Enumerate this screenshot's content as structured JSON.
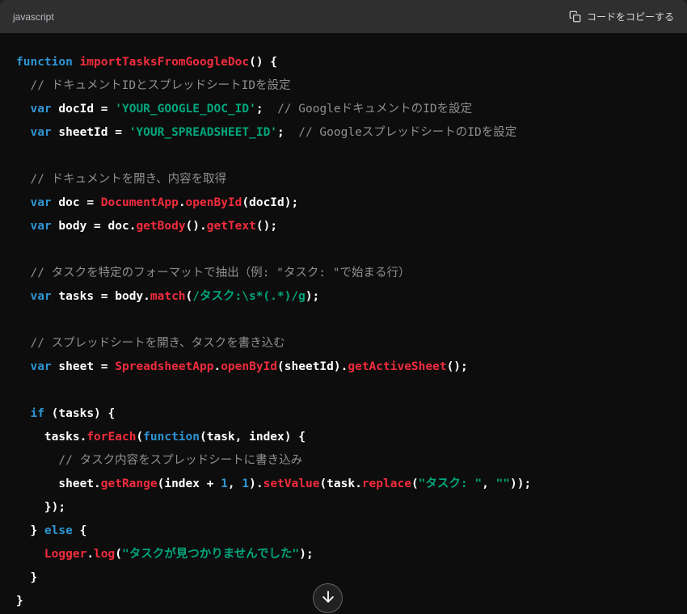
{
  "header": {
    "language": "javascript",
    "copy_label": "コードをコピーする"
  },
  "colors": {
    "page_bg": "#212121",
    "code_bg": "#0d0d0d",
    "header_bg": "#2f2f2f",
    "header_text": "#b8bcc3",
    "header_text2": "#d7d7d7",
    "keyword": "#2e95d3",
    "function": "#f22c3d",
    "string": "#00a67d",
    "number": "#2e95d3",
    "comment": "#8f8f8f",
    "plain": "#ffffff"
  },
  "code": {
    "lines": [
      [
        {
          "s": "function",
          "c": "kw"
        },
        {
          "s": " ",
          "c": "pl"
        },
        {
          "s": "importTasksFromGoogleDoc",
          "c": "fn"
        },
        {
          "s": "() {",
          "c": "pl"
        }
      ],
      [
        {
          "s": "  ",
          "c": "pl"
        },
        {
          "s": "// ドキュメントIDとスプレッドシートIDを設定",
          "c": "com"
        }
      ],
      [
        {
          "s": "  ",
          "c": "pl"
        },
        {
          "s": "var",
          "c": "kw"
        },
        {
          "s": " docId = ",
          "c": "pl"
        },
        {
          "s": "'YOUR_GOOGLE_DOC_ID'",
          "c": "str"
        },
        {
          "s": ";  ",
          "c": "pl"
        },
        {
          "s": "// GoogleドキュメントのIDを設定",
          "c": "com"
        }
      ],
      [
        {
          "s": "  ",
          "c": "pl"
        },
        {
          "s": "var",
          "c": "kw"
        },
        {
          "s": " sheetId = ",
          "c": "pl"
        },
        {
          "s": "'YOUR_SPREADSHEET_ID'",
          "c": "str"
        },
        {
          "s": ";  ",
          "c": "pl"
        },
        {
          "s": "// GoogleスプレッドシートのIDを設定",
          "c": "com"
        }
      ],
      [],
      [
        {
          "s": "  ",
          "c": "pl"
        },
        {
          "s": "// ドキュメントを開き、内容を取得",
          "c": "com"
        }
      ],
      [
        {
          "s": "  ",
          "c": "pl"
        },
        {
          "s": "var",
          "c": "kw"
        },
        {
          "s": " doc = ",
          "c": "pl"
        },
        {
          "s": "DocumentApp",
          "c": "fn"
        },
        {
          "s": ".",
          "c": "pl"
        },
        {
          "s": "openById",
          "c": "fn"
        },
        {
          "s": "(docId);",
          "c": "pl"
        }
      ],
      [
        {
          "s": "  ",
          "c": "pl"
        },
        {
          "s": "var",
          "c": "kw"
        },
        {
          "s": " body = doc.",
          "c": "pl"
        },
        {
          "s": "getBody",
          "c": "fn"
        },
        {
          "s": "().",
          "c": "pl"
        },
        {
          "s": "getText",
          "c": "fn"
        },
        {
          "s": "();",
          "c": "pl"
        }
      ],
      [],
      [
        {
          "s": "  ",
          "c": "pl"
        },
        {
          "s": "// タスクを特定のフォーマットで抽出（例: \"タスク: \"で始まる行）",
          "c": "com"
        }
      ],
      [
        {
          "s": "  ",
          "c": "pl"
        },
        {
          "s": "var",
          "c": "kw"
        },
        {
          "s": " tasks = body.",
          "c": "pl"
        },
        {
          "s": "match",
          "c": "fn"
        },
        {
          "s": "(",
          "c": "pl"
        },
        {
          "s": "/タスク:\\s*(.*)/g",
          "c": "str"
        },
        {
          "s": ");",
          "c": "pl"
        }
      ],
      [],
      [
        {
          "s": "  ",
          "c": "pl"
        },
        {
          "s": "// スプレッドシートを開き、タスクを書き込む",
          "c": "com"
        }
      ],
      [
        {
          "s": "  ",
          "c": "pl"
        },
        {
          "s": "var",
          "c": "kw"
        },
        {
          "s": " sheet = ",
          "c": "pl"
        },
        {
          "s": "SpreadsheetApp",
          "c": "fn"
        },
        {
          "s": ".",
          "c": "pl"
        },
        {
          "s": "openById",
          "c": "fn"
        },
        {
          "s": "(sheetId).",
          "c": "pl"
        },
        {
          "s": "getActiveSheet",
          "c": "fn"
        },
        {
          "s": "();",
          "c": "pl"
        }
      ],
      [],
      [
        {
          "s": "  ",
          "c": "pl"
        },
        {
          "s": "if",
          "c": "kw"
        },
        {
          "s": " (tasks) {",
          "c": "pl"
        }
      ],
      [
        {
          "s": "    tasks.",
          "c": "pl"
        },
        {
          "s": "forEach",
          "c": "fn"
        },
        {
          "s": "(",
          "c": "pl"
        },
        {
          "s": "function",
          "c": "kw"
        },
        {
          "s": "(task, index) {",
          "c": "pl"
        }
      ],
      [
        {
          "s": "      ",
          "c": "pl"
        },
        {
          "s": "// タスク内容をスプレッドシートに書き込み",
          "c": "com"
        }
      ],
      [
        {
          "s": "      sheet.",
          "c": "pl"
        },
        {
          "s": "getRange",
          "c": "fn"
        },
        {
          "s": "(index + ",
          "c": "pl"
        },
        {
          "s": "1",
          "c": "num"
        },
        {
          "s": ", ",
          "c": "pl"
        },
        {
          "s": "1",
          "c": "num"
        },
        {
          "s": ").",
          "c": "pl"
        },
        {
          "s": "setValue",
          "c": "fn"
        },
        {
          "s": "(task.",
          "c": "pl"
        },
        {
          "s": "replace",
          "c": "fn"
        },
        {
          "s": "(",
          "c": "pl"
        },
        {
          "s": "\"タスク: \"",
          "c": "str"
        },
        {
          "s": ", ",
          "c": "pl"
        },
        {
          "s": "\"\"",
          "c": "str"
        },
        {
          "s": "));",
          "c": "pl"
        }
      ],
      [
        {
          "s": "    });",
          "c": "pl"
        }
      ],
      [
        {
          "s": "  } ",
          "c": "pl"
        },
        {
          "s": "else",
          "c": "kw"
        },
        {
          "s": " {",
          "c": "pl"
        }
      ],
      [
        {
          "s": "    ",
          "c": "pl"
        },
        {
          "s": "Logger",
          "c": "fn"
        },
        {
          "s": ".",
          "c": "pl"
        },
        {
          "s": "log",
          "c": "fn"
        },
        {
          "s": "(",
          "c": "pl"
        },
        {
          "s": "\"タスクが見つかりませんでした\"",
          "c": "str"
        },
        {
          "s": ");",
          "c": "pl"
        }
      ],
      [
        {
          "s": "  }",
          "c": "pl"
        }
      ],
      [
        {
          "s": "}",
          "c": "pl"
        }
      ]
    ]
  },
  "scroll_button": {
    "icon": "arrow-down"
  }
}
